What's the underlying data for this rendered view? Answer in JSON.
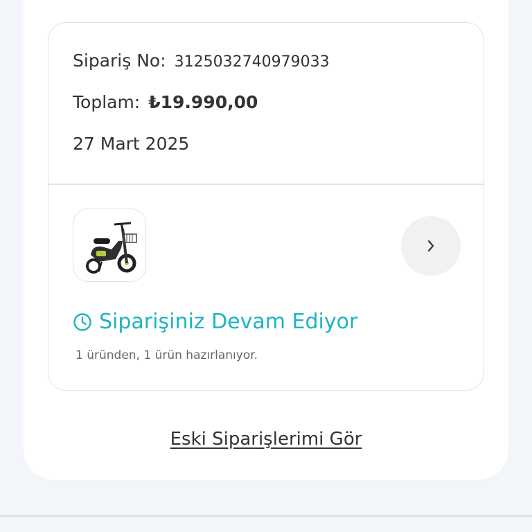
{
  "order": {
    "number_label": "Sipariş No:",
    "number_value": "3125032740979033",
    "total_label": "Toplam:",
    "total_value": "₺19.990,00",
    "date": "27 Mart 2025"
  },
  "status": {
    "icon": "clock-icon",
    "title": "Siparişiniz Devam Ediyor",
    "subtitle": "1 üründen, 1 ürün hazırlanıyor.",
    "color": "#1fb3c1"
  },
  "product": {
    "icon": "electric-scooter-image"
  },
  "detail": {
    "icon": "chevron-right-icon"
  },
  "footer": {
    "old_orders_link": "Eski Siparişlerimi Gör"
  }
}
